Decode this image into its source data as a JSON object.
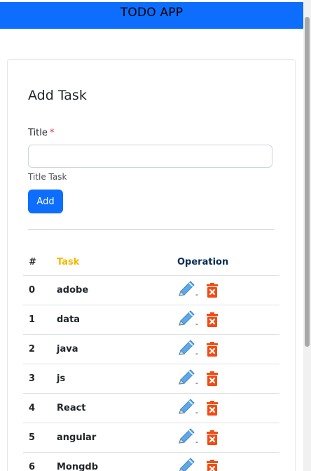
{
  "app": {
    "title": "TODO APP"
  },
  "form": {
    "heading": "Add Task",
    "title_label": "Title",
    "required_mark": "*",
    "title_value": "",
    "title_placeholder": "",
    "help_text": "Title Task",
    "add_label": "Add"
  },
  "table": {
    "headers": {
      "num": "#",
      "task": "Task",
      "operation": "Operation"
    },
    "rows": [
      {
        "num": "0",
        "task": "adobe"
      },
      {
        "num": "1",
        "task": "data"
      },
      {
        "num": "2",
        "task": "java"
      },
      {
        "num": "3",
        "task": "js"
      },
      {
        "num": "4",
        "task": "React"
      },
      {
        "num": "5",
        "task": "angular"
      },
      {
        "num": "6",
        "task": "Mongdb"
      }
    ],
    "edit_suffix": "-"
  },
  "icons": {
    "edit": "pencil-icon",
    "delete": "trash-icon"
  },
  "colors": {
    "primary": "#0d6efd",
    "task_header": "#f5b800",
    "operation_header": "#0b2b55",
    "delete": "#f24c14",
    "pencil": "#5ea8e8",
    "required": "#dc3545"
  }
}
